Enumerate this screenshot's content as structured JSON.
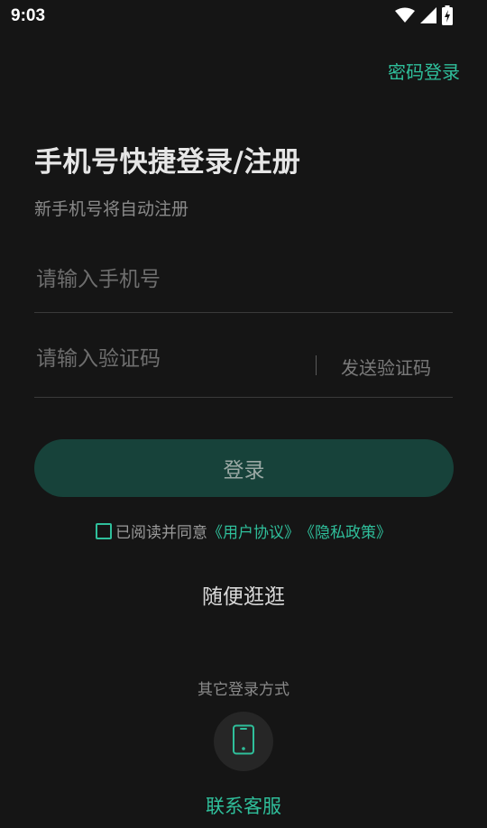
{
  "status_bar": {
    "time": "9:03",
    "icons": [
      "wifi-icon",
      "signal-icon",
      "battery-charging-icon"
    ]
  },
  "header": {
    "password_login": "密码登录"
  },
  "title": "手机号快捷登录/注册",
  "subtitle": "新手机号将自动注册",
  "form": {
    "phone_placeholder": "请输入手机号",
    "code_placeholder": "请输入验证码",
    "send_code": "发送验证码",
    "login_button": "登录"
  },
  "agreement": {
    "prefix": "已阅读并同意",
    "user_agreement": "《用户协议》",
    "privacy_policy": "《隐私政策》"
  },
  "browse": "随便逛逛",
  "other_login": {
    "label": "其它登录方式",
    "icon": "phone-icon"
  },
  "contact_service": "联系客服",
  "colors": {
    "background": "#151515",
    "accent": "#2fbf9b",
    "button_bg": "#17423a"
  }
}
